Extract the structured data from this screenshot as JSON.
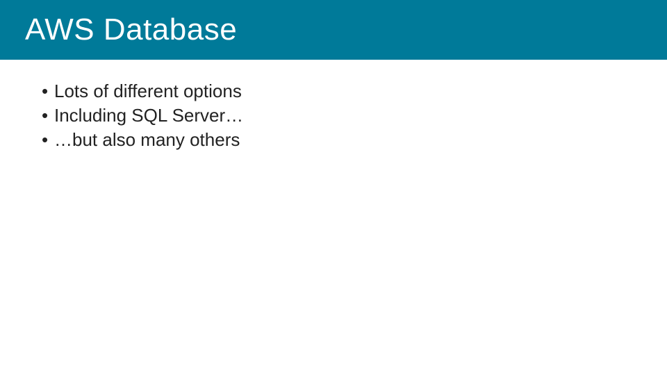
{
  "slide": {
    "title": "AWS Database",
    "bullets": [
      "Lots of different options",
      "Including SQL Server…",
      "…but also many others"
    ]
  }
}
